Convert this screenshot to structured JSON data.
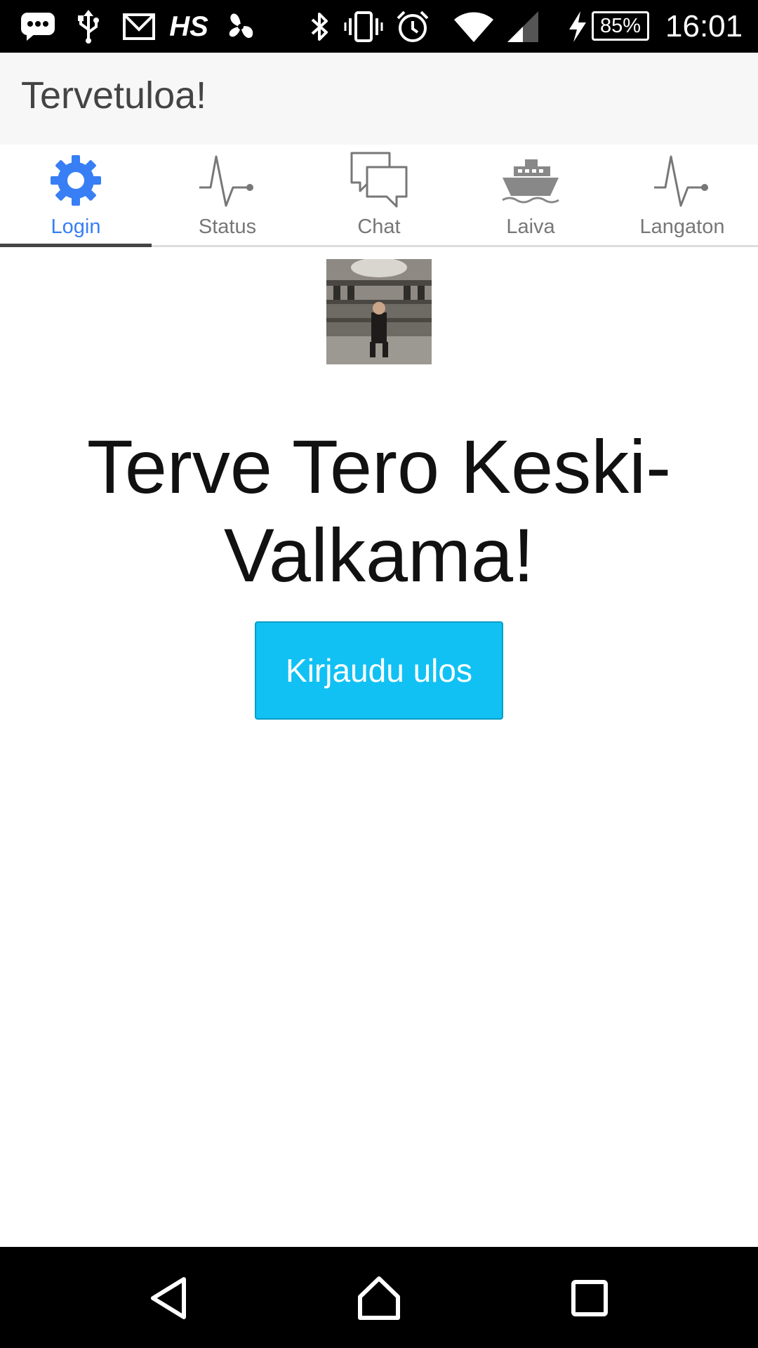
{
  "status_bar": {
    "icons": [
      "message-icon",
      "usb-icon",
      "gmail-icon",
      "hs-app-icon",
      "pinwheel-icon",
      "bluetooth-icon",
      "vibrate-icon",
      "alarm-icon",
      "wifi-icon",
      "cell-signal-icon",
      "charging-icon"
    ],
    "hs_label": "HS",
    "battery": "85%",
    "time": "16:01"
  },
  "app_bar": {
    "title": "Tervetuloa!"
  },
  "tabs": [
    {
      "label": "Login",
      "icon": "gear-icon",
      "active": true
    },
    {
      "label": "Status",
      "icon": "pulse-icon",
      "active": false
    },
    {
      "label": "Chat",
      "icon": "chat-bubbles-icon",
      "active": false
    },
    {
      "label": "Laiva",
      "icon": "ship-icon",
      "active": false
    },
    {
      "label": "Langaton",
      "icon": "pulse-icon",
      "active": false
    }
  ],
  "main": {
    "avatar_alt": "user-photo",
    "greeting": "Terve Tero Keski-Valkama!",
    "logout_label": "Kirjaudu ulos"
  },
  "nav_bar": {
    "buttons": [
      "back-icon",
      "home-icon",
      "recents-icon"
    ]
  },
  "colors": {
    "accent": "#387ef5",
    "button": "#11c1f3",
    "tab_inactive": "#777777",
    "app_bar_bg": "#f7f7f7"
  }
}
